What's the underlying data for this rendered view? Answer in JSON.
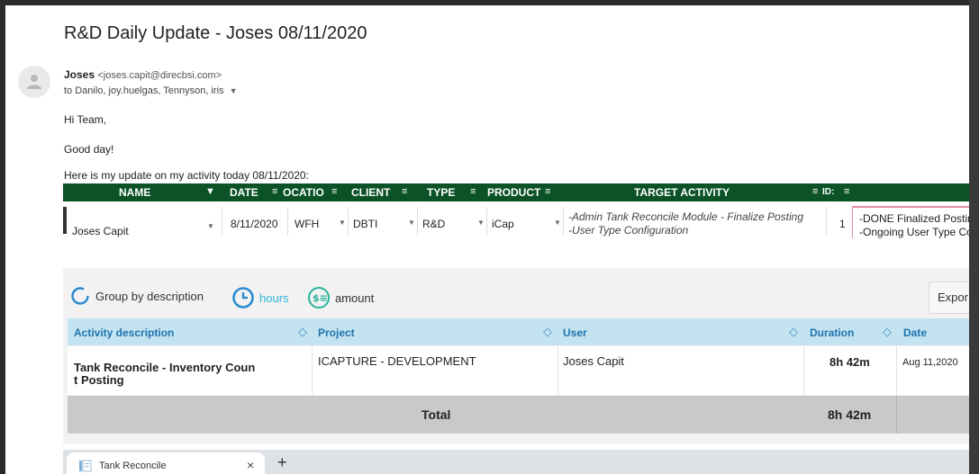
{
  "email": {
    "subject": "R&D Daily Update - Joses 08/11/2020",
    "sender_name": "Joses",
    "sender_email": "<joses.capit@direcbsi.com>",
    "to_line": "to Danilo, joy.huelgas, Tennyson, iris",
    "greeting": "Hi Team,",
    "line2": "Good day!",
    "line3": "Here is my update on my activity today 08/11/2020:"
  },
  "sheet": {
    "headers": [
      "NAME",
      "DATE",
      "OCATIO",
      "CLIENT",
      "TYPE",
      "PRODUCT",
      "TARGET ACTIVITY",
      "ID:"
    ],
    "row": {
      "name": "Joses Capit",
      "date": "8/11/2020",
      "location": "WFH",
      "client": "DBTI",
      "type": "R&D",
      "product": "iCap",
      "target1": "-Admin Tank Reconcile Module - Finalize Posting",
      "target2": "-User Type Configuration",
      "num": "1",
      "status1": "-DONE Finalized Posting",
      "status2": "-Ongoing User Type Con"
    }
  },
  "timesheet": {
    "group_label": "Group by description",
    "hours_label": "hours",
    "amount_label": "amount",
    "export_label": "Expor",
    "columns": [
      "Activity description",
      "Project",
      "User",
      "Duration",
      "Date"
    ],
    "row": {
      "activity_line1": "Tank Reconcile - Inventory Coun",
      "activity_line2": "t Posting",
      "project": "ICAPTURE - DEVELOPMENT",
      "user": "Joses Capit",
      "duration": "8h 42m",
      "date": "Aug 11,2020"
    },
    "total_label": "Total",
    "total_duration": "8h 42m"
  },
  "browser": {
    "tab_title": "Tank Reconcile",
    "close": "×",
    "new_tab": "+"
  }
}
